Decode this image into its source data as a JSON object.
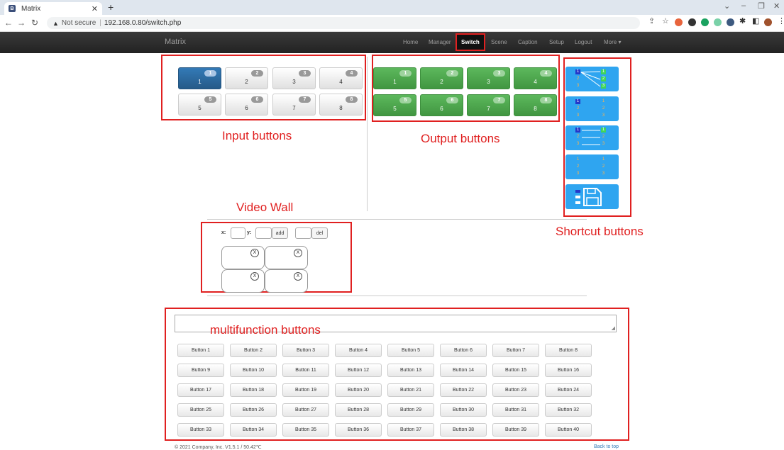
{
  "browser": {
    "tab_title": "Matrix",
    "tab_favicon": "B",
    "url_warning": "Not secure",
    "url": "192.168.0.80/switch.php"
  },
  "navbar": {
    "brand": "Matrix",
    "links": [
      "Home",
      "Manager",
      "Switch",
      "Scene",
      "Caption",
      "Setup",
      "Logout",
      "More ▾"
    ],
    "active": "Switch"
  },
  "annotations": {
    "input": "Input buttons",
    "output": "Output buttons",
    "shortcut": "Shortcut buttons",
    "videowall": "Video Wall",
    "multi": "multifunction buttons"
  },
  "inputs": [
    {
      "label": "1",
      "badge": "1",
      "active": true
    },
    {
      "label": "2",
      "badge": "2"
    },
    {
      "label": "3",
      "badge": "3"
    },
    {
      "label": "4",
      "badge": "4"
    },
    {
      "label": "5",
      "badge": "5"
    },
    {
      "label": "6",
      "badge": "6"
    },
    {
      "label": "7",
      "badge": "7"
    },
    {
      "label": "8",
      "badge": "8"
    }
  ],
  "outputs": [
    {
      "label": "1",
      "badge": "1"
    },
    {
      "label": "2",
      "badge": "2"
    },
    {
      "label": "3",
      "badge": "3"
    },
    {
      "label": "4",
      "badge": "4"
    },
    {
      "label": "5",
      "badge": "5"
    },
    {
      "label": "6",
      "badge": "6"
    },
    {
      "label": "7",
      "badge": "7"
    },
    {
      "label": "8",
      "badge": "8"
    }
  ],
  "shortcut_labels": [
    "1",
    "2",
    "3"
  ],
  "videowall": {
    "x_label": "x:",
    "y_label": "y:",
    "add": "add",
    "del": "del",
    "close": "X"
  },
  "multifunction": [
    "Button 1",
    "Button 2",
    "Button 3",
    "Button 4",
    "Button 5",
    "Button 6",
    "Button 7",
    "Button 8",
    "Button 9",
    "Button 10",
    "Button 11",
    "Button 12",
    "Button 13",
    "Button 14",
    "Button 15",
    "Button 16",
    "Button 17",
    "Button 18",
    "Button 19",
    "Button 20",
    "Button 21",
    "Button 22",
    "Button 23",
    "Button 24",
    "Button 25",
    "Button 26",
    "Button 27",
    "Button 28",
    "Button 29",
    "Button 30",
    "Button 31",
    "Button 32",
    "Button 33",
    "Button 34",
    "Button 35",
    "Button 36",
    "Button 37",
    "Button 38",
    "Button 39",
    "Button 40"
  ],
  "footer": {
    "copyright": "© 2021 Company, Inc. V1.5.1 / 50.42℃",
    "back_to_top": "Back to top"
  },
  "colors": {
    "accent_red": "#e02020",
    "input_active": "#337ab7",
    "output_green": "#5cb85c",
    "shortcut_blue": "#2fa5f0"
  }
}
